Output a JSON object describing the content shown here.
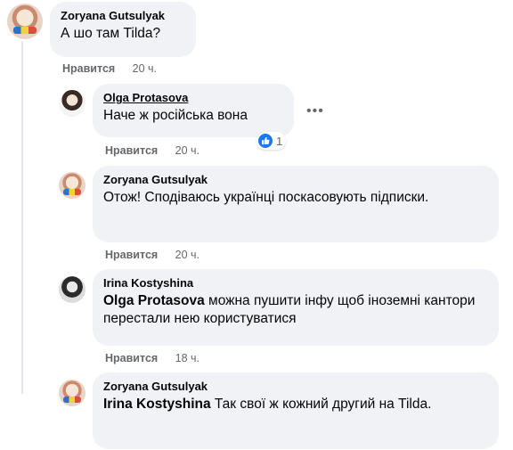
{
  "comments": [
    {
      "author": "Zoryana Gutsulyak",
      "text": "А шо там Tilda?",
      "like_label": "Нравится",
      "time": "20 ч."
    },
    {
      "author": "Olga Protasova",
      "text": "Наче ж російська вона",
      "like_label": "Нравится",
      "time": "20 ч.",
      "reaction_count": "1",
      "more_label": "•••"
    },
    {
      "author": "Zoryana Gutsulyak",
      "text": "Отож! Сподіваюсь українці поскасовують підписки.",
      "like_label": "Нравится",
      "time": "20 ч."
    },
    {
      "author": "Irina Kostyshina",
      "mention": "Olga Protasova",
      "text": "можна пушити інфу щоб іноземні кантори перестали нею користуватися",
      "like_label": "Нравится",
      "time": "18 ч."
    },
    {
      "author": "Zoryana Gutsulyak",
      "mention": "Irina Kostyshina",
      "text": "Так свої ж кожний другий на Tilda."
    }
  ]
}
